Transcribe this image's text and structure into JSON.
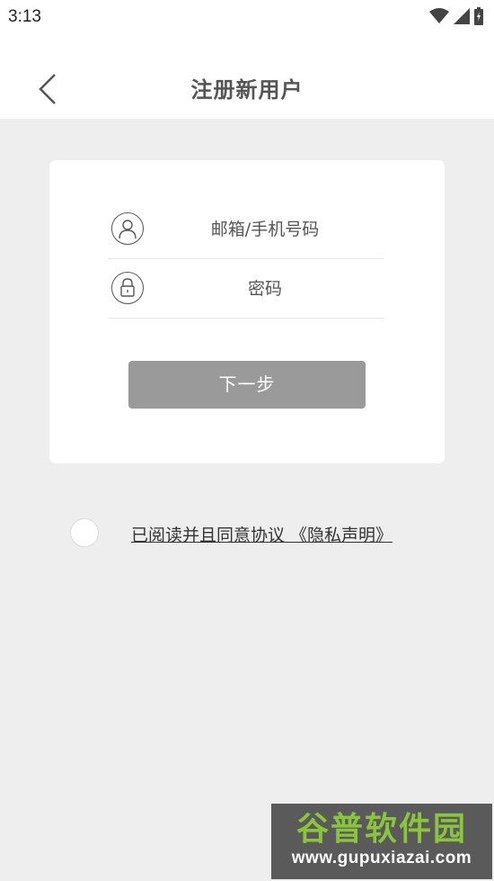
{
  "status_bar": {
    "time": "3:13",
    "icons": [
      "wifi-icon",
      "signal-icon",
      "battery-icon"
    ]
  },
  "header": {
    "title": "注册新用户",
    "back_icon": "chevron-left-icon"
  },
  "form": {
    "account_field": {
      "icon": "user-icon",
      "placeholder": "邮箱/手机号码",
      "value": ""
    },
    "password_field": {
      "icon": "lock-icon",
      "placeholder": "密码",
      "value": ""
    },
    "next_button_label": "下一步",
    "next_button_color": "#9a9a9a"
  },
  "agreement": {
    "checked": false,
    "text": "已阅读并且同意协议 《隐私声明》"
  },
  "watermark": {
    "logo_text": "谷普软件园",
    "url": "www.gupuxiazai.com"
  },
  "colors": {
    "background": "#eeeeee",
    "card": "#ffffff",
    "button": "#9a9a9a"
  }
}
